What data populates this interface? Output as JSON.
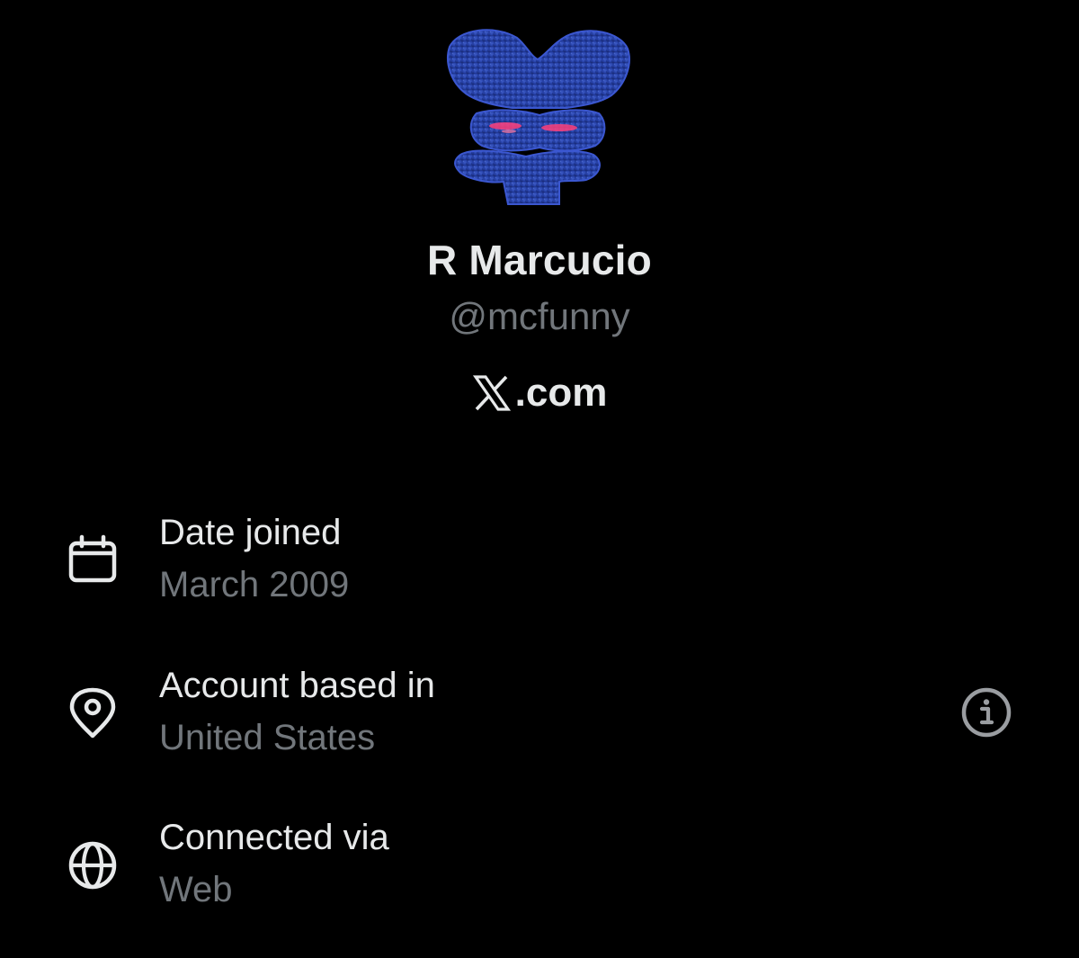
{
  "profile": {
    "display_name": "R Marcucio",
    "handle": "@mcfunny",
    "avatar_icon": "brain-section-avatar"
  },
  "brand": {
    "logo_icon": "x-logo-icon",
    "text": ".com"
  },
  "details": [
    {
      "icon": "calendar-icon",
      "label": "Date joined",
      "value": "March 2009"
    },
    {
      "icon": "location-pin-icon",
      "label": "Account based in",
      "value": "United States",
      "has_info": true
    },
    {
      "icon": "globe-icon",
      "label": "Connected via",
      "value": "Web"
    }
  ],
  "colors": {
    "background": "#000000",
    "primary_text": "#e7e9ea",
    "secondary_text": "#71767b",
    "info_icon": "#9a9da1"
  }
}
